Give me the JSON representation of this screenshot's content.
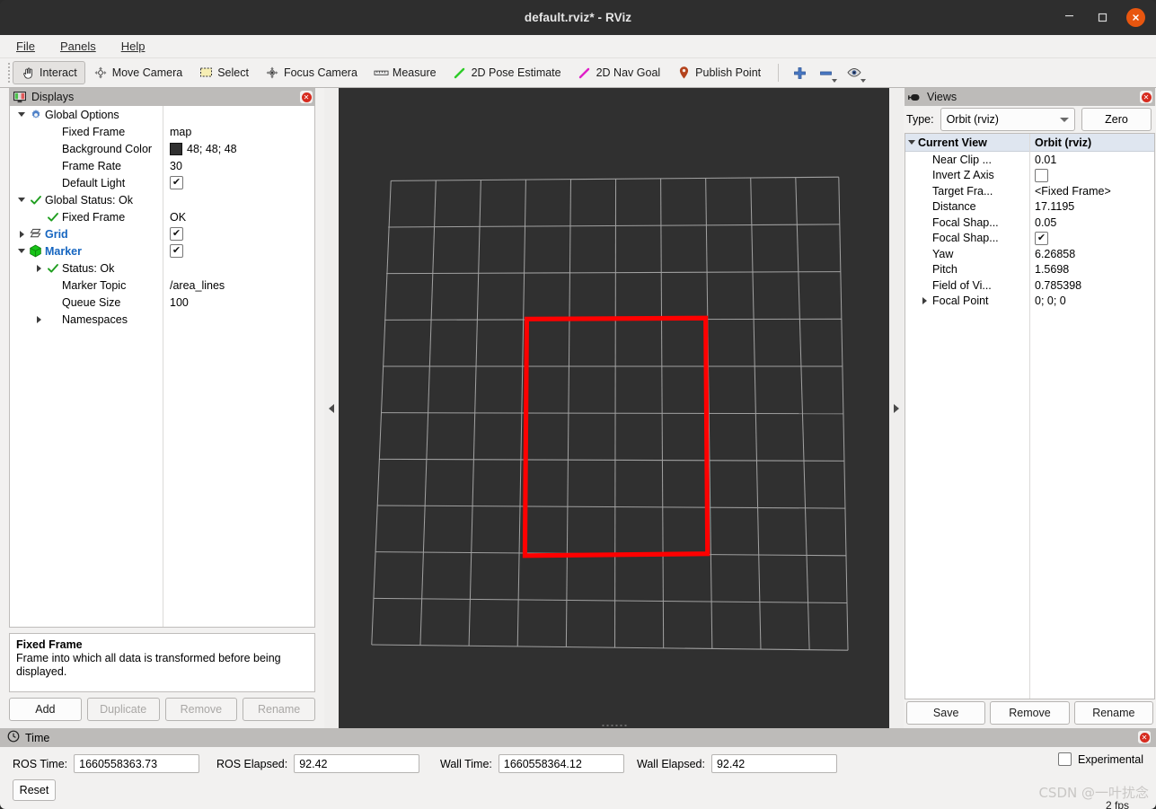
{
  "window": {
    "title": "default.rviz* - RViz",
    "minimize_label": "–",
    "maximize_label": "□",
    "close_label": "✕"
  },
  "menu": {
    "items": [
      {
        "label": "File",
        "accel": "F"
      },
      {
        "label": "Panels",
        "accel": "P"
      },
      {
        "label": "Help",
        "accel": "H"
      }
    ]
  },
  "toolbar": {
    "buttons": [
      {
        "label": "Interact",
        "icon": "hand-cursor-icon",
        "active": true
      },
      {
        "label": "Move Camera",
        "icon": "move-camera-icon",
        "active": false
      },
      {
        "label": "Select",
        "icon": "select-rectangle-icon",
        "active": false
      },
      {
        "label": "Focus Camera",
        "icon": "focus-camera-icon",
        "active": false
      },
      {
        "label": "Measure",
        "icon": "ruler-icon",
        "active": false
      },
      {
        "label": "2D Pose Estimate",
        "icon": "green-arrow-icon",
        "active": false
      },
      {
        "label": "2D Nav Goal",
        "icon": "magenta-arrow-icon",
        "active": false
      },
      {
        "label": "Publish Point",
        "icon": "map-pin-icon",
        "active": false
      }
    ],
    "right_icons": [
      {
        "name": "add-tool-icon",
        "glyph": "+"
      },
      {
        "name": "remove-tool-icon",
        "glyph": "−"
      },
      {
        "name": "eye-visibility-icon",
        "glyph": "eye"
      }
    ]
  },
  "displays_panel": {
    "header": "Displays",
    "header_icon": "displays-monitor-icon",
    "close_icon": "close-panel-icon",
    "tree": [
      {
        "indent": 0,
        "expander": "down",
        "icon": "gear-icon",
        "label": "Global Options",
        "label_style": "plain",
        "value": "",
        "value_type": "none"
      },
      {
        "indent": 1,
        "expander": "none",
        "icon": "none",
        "label": "Fixed Frame",
        "label_style": "plain",
        "value": "map",
        "value_type": "text"
      },
      {
        "indent": 1,
        "expander": "none",
        "icon": "none",
        "label": "Background Color",
        "label_style": "plain",
        "value": "48; 48; 48",
        "value_type": "color",
        "color": "#303030"
      },
      {
        "indent": 1,
        "expander": "none",
        "icon": "none",
        "label": "Frame Rate",
        "label_style": "plain",
        "value": "30",
        "value_type": "text"
      },
      {
        "indent": 1,
        "expander": "none",
        "icon": "none",
        "label": "Default Light",
        "label_style": "plain",
        "value": "checked",
        "value_type": "checkbox"
      },
      {
        "indent": 0,
        "expander": "down",
        "icon": "check-green-icon",
        "label": "Global Status: Ok",
        "label_style": "plain",
        "value": "",
        "value_type": "none"
      },
      {
        "indent": 1,
        "expander": "none",
        "icon": "check-green-icon",
        "label": "Fixed Frame",
        "label_style": "plain",
        "value": "OK",
        "value_type": "text"
      },
      {
        "indent": 0,
        "expander": "right",
        "icon": "grid-icon",
        "label": "Grid",
        "label_style": "blue",
        "value": "checked",
        "value_type": "checkbox"
      },
      {
        "indent": 0,
        "expander": "down",
        "icon": "marker-cube-icon",
        "label": "Marker",
        "label_style": "blue",
        "value": "checked",
        "value_type": "checkbox"
      },
      {
        "indent": 1,
        "expander": "right",
        "icon": "check-green-icon",
        "label": "Status: Ok",
        "label_style": "plain",
        "value": "",
        "value_type": "none"
      },
      {
        "indent": 1,
        "expander": "none",
        "icon": "none",
        "label": "Marker Topic",
        "label_style": "plain",
        "value": "/area_lines",
        "value_type": "text"
      },
      {
        "indent": 1,
        "expander": "none",
        "icon": "none",
        "label": "Queue Size",
        "label_style": "plain",
        "value": "100",
        "value_type": "text"
      },
      {
        "indent": 1,
        "expander": "right",
        "icon": "none",
        "label": "Namespaces",
        "label_style": "plain",
        "value": "",
        "value_type": "none"
      }
    ],
    "help": {
      "title": "Fixed Frame",
      "body": "Frame into which all data is transformed before being displayed."
    },
    "buttons": [
      {
        "label": "Add",
        "enabled": true
      },
      {
        "label": "Duplicate",
        "enabled": false
      },
      {
        "label": "Remove",
        "enabled": false
      },
      {
        "label": "Rename",
        "enabled": false
      }
    ]
  },
  "viewport": {
    "background_color": "#303030",
    "grid_color": "#b4b4b4",
    "marker_color": "#ff0000",
    "grid_cells": 10
  },
  "views_panel": {
    "header": "Views",
    "header_icon": "views-camera-icon",
    "close_icon": "close-panel-icon",
    "type_label": "Type:",
    "type_value": "Orbit (rviz)",
    "zero_label": "Zero",
    "tree_header": {
      "name": "Current View",
      "value": "Orbit (rviz)"
    },
    "rows": [
      {
        "label": "Near Clip ...",
        "value": "0.01",
        "value_type": "text",
        "expander": "none"
      },
      {
        "label": "Invert Z Axis",
        "value": "unchecked",
        "value_type": "checkbox",
        "expander": "none"
      },
      {
        "label": "Target Fra...",
        "value": "<Fixed Frame>",
        "value_type": "text",
        "expander": "none"
      },
      {
        "label": "Distance",
        "value": "17.1195",
        "value_type": "text",
        "expander": "none"
      },
      {
        "label": "Focal Shap...",
        "value": "0.05",
        "value_type": "text",
        "expander": "none"
      },
      {
        "label": "Focal Shap...",
        "value": "checked",
        "value_type": "checkbox",
        "expander": "none"
      },
      {
        "label": "Yaw",
        "value": "6.26858",
        "value_type": "text",
        "expander": "none"
      },
      {
        "label": "Pitch",
        "value": "1.5698",
        "value_type": "text",
        "expander": "none"
      },
      {
        "label": "Field of Vi...",
        "value": "0.785398",
        "value_type": "text",
        "expander": "none"
      },
      {
        "label": "Focal Point",
        "value": "0; 0; 0",
        "value_type": "text",
        "expander": "right"
      }
    ],
    "buttons": [
      {
        "label": "Save",
        "enabled": true
      },
      {
        "label": "Remove",
        "enabled": true
      },
      {
        "label": "Rename",
        "enabled": true
      }
    ]
  },
  "time_panel": {
    "header": "Time",
    "header_icon": "clock-icon",
    "close_icon": "close-panel-icon",
    "fields": [
      {
        "label": "ROS Time:",
        "value": "1660558363.73"
      },
      {
        "label": "ROS Elapsed:",
        "value": "92.42"
      },
      {
        "label": "Wall Time:",
        "value": "1660558364.12"
      },
      {
        "label": "Wall Elapsed:",
        "value": "92.42"
      }
    ],
    "reset_label": "Reset",
    "experimental_label": "Experimental",
    "experimental_checked": false,
    "fps": "2 fps",
    "watermark": "CSDN @一叶扰念"
  }
}
